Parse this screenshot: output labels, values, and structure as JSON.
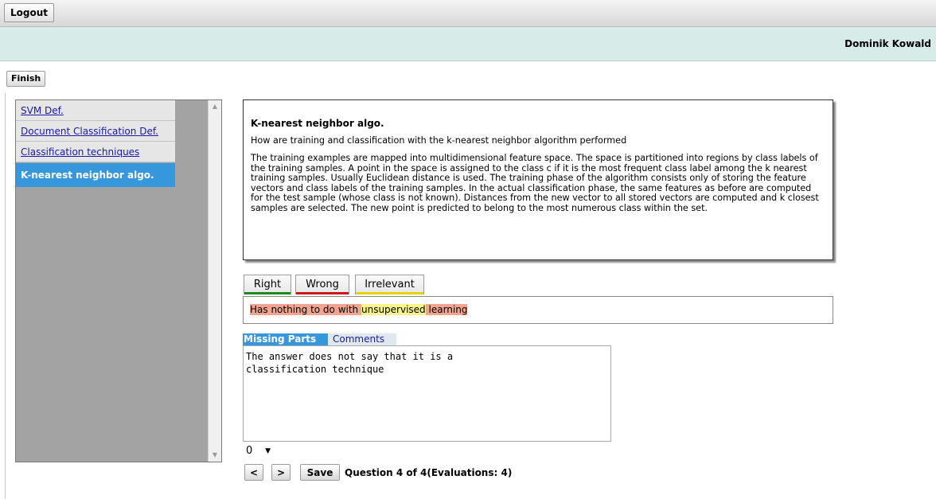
{
  "toolbar": {
    "logout_label": "Logout"
  },
  "header": {
    "username": "Dominik Kowald"
  },
  "actions": {
    "finish_label": "Finish"
  },
  "sidebar": {
    "items": [
      {
        "label": "SVM Def.",
        "active": false
      },
      {
        "label": "Document Classification Def.",
        "active": false
      },
      {
        "label": "Classification techniques",
        "active": false
      },
      {
        "label": "K-nearest neighbor algo.",
        "active": true
      }
    ]
  },
  "question": {
    "title": "K-nearest neighbor algo.",
    "text": "How are training and classification with the k-nearest neighbor algorithm performed",
    "answer": "The training examples are mapped into multidimensional feature space. The space is partitioned into regions by class labels of the training samples. A point in the space is assigned to the class c if it is the most frequent class label among the k nearest training samples. Usually Euclidean distance is used. The training phase of the algorithm consists only of storing the feature vectors and class labels of the training samples. In the actual classification phase, the same features as before are computed for the test sample (whose class is not known). Distances from the new vector to all stored vectors are computed and k closest samples are selected. The new point is predicted to belong to the most numerous class within the set."
  },
  "tabs": [
    {
      "label": "Right",
      "color": "#1e8a1e"
    },
    {
      "label": "Wrong",
      "color": "#d01818"
    },
    {
      "label": "Irrelevant",
      "color": "#e6d400"
    }
  ],
  "annotation": {
    "segments": [
      {
        "text": "Has nothing to do with ",
        "color": "#f2a58e"
      },
      {
        "text": "unsupervised",
        "color": "#f7f28a"
      },
      {
        "text": " learning",
        "color": "#f2a58e"
      }
    ]
  },
  "feedback": {
    "missing_tab": "Missing Parts",
    "comments_tab": "Comments",
    "missing_text": "The answer does not say that it is a\nclassification technique"
  },
  "score": {
    "selected": "0"
  },
  "nav": {
    "prev_label": "<",
    "next_label": ">",
    "save_label": "Save",
    "status": "Question 4 of 4(Evaluations: 4)"
  }
}
